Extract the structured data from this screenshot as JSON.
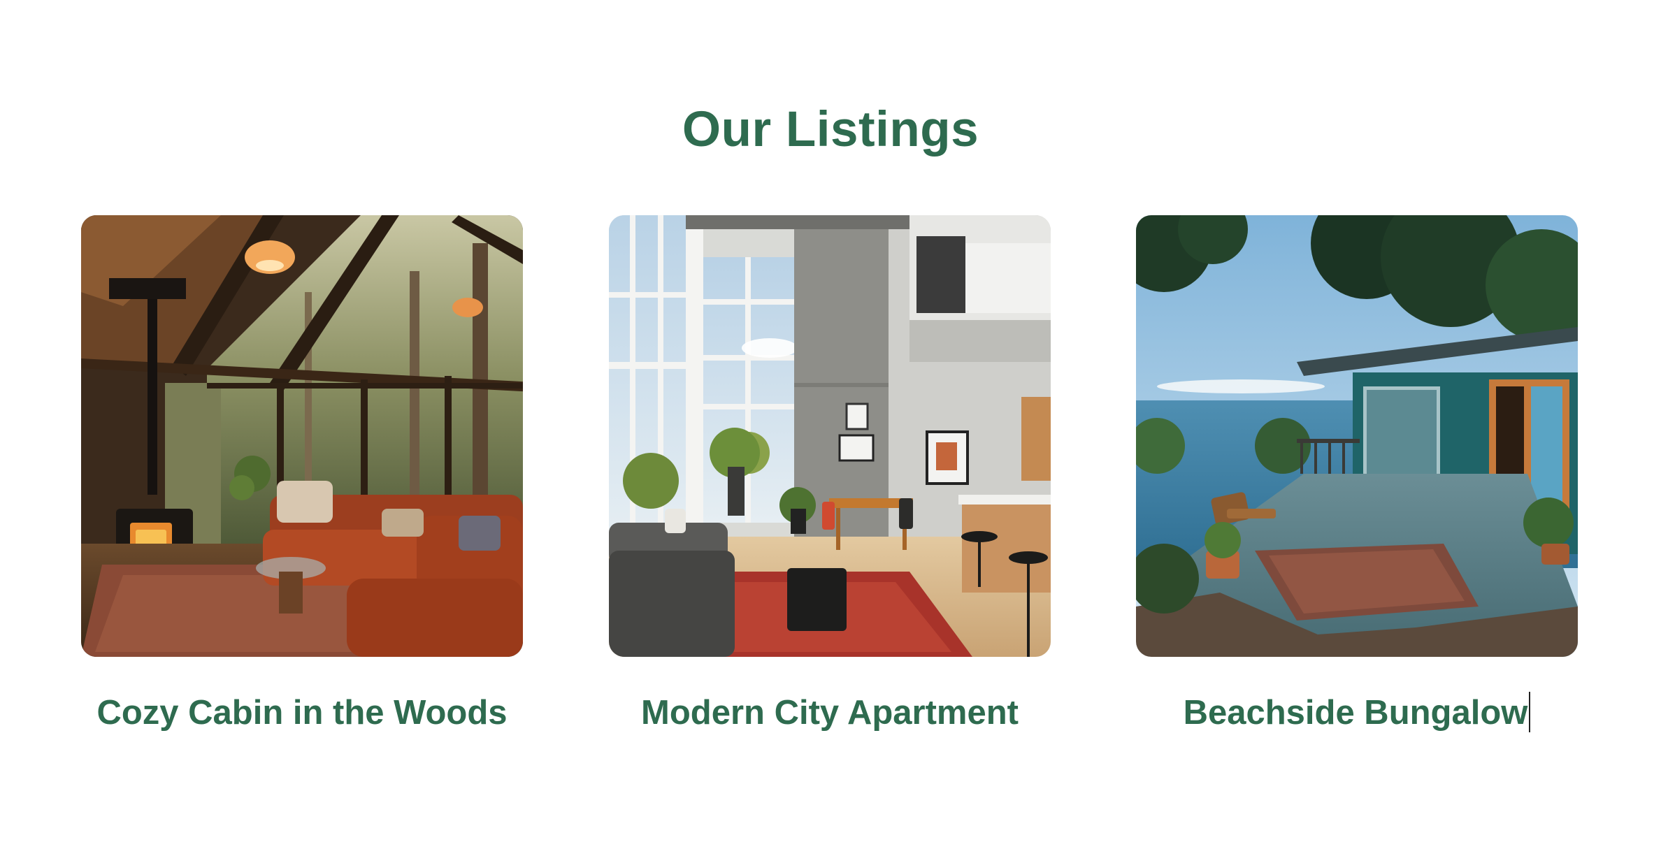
{
  "section": {
    "title": "Our Listings"
  },
  "listings": [
    {
      "title": "Cozy Cabin in the Woods",
      "image": "cabin-interior-photo"
    },
    {
      "title": "Modern City Apartment",
      "image": "apartment-interior-photo"
    },
    {
      "title": "Beachside Bungalow",
      "image": "bungalow-deck-photo"
    }
  ],
  "colors": {
    "heading": "#2e6b4f",
    "background": "#ffffff"
  }
}
